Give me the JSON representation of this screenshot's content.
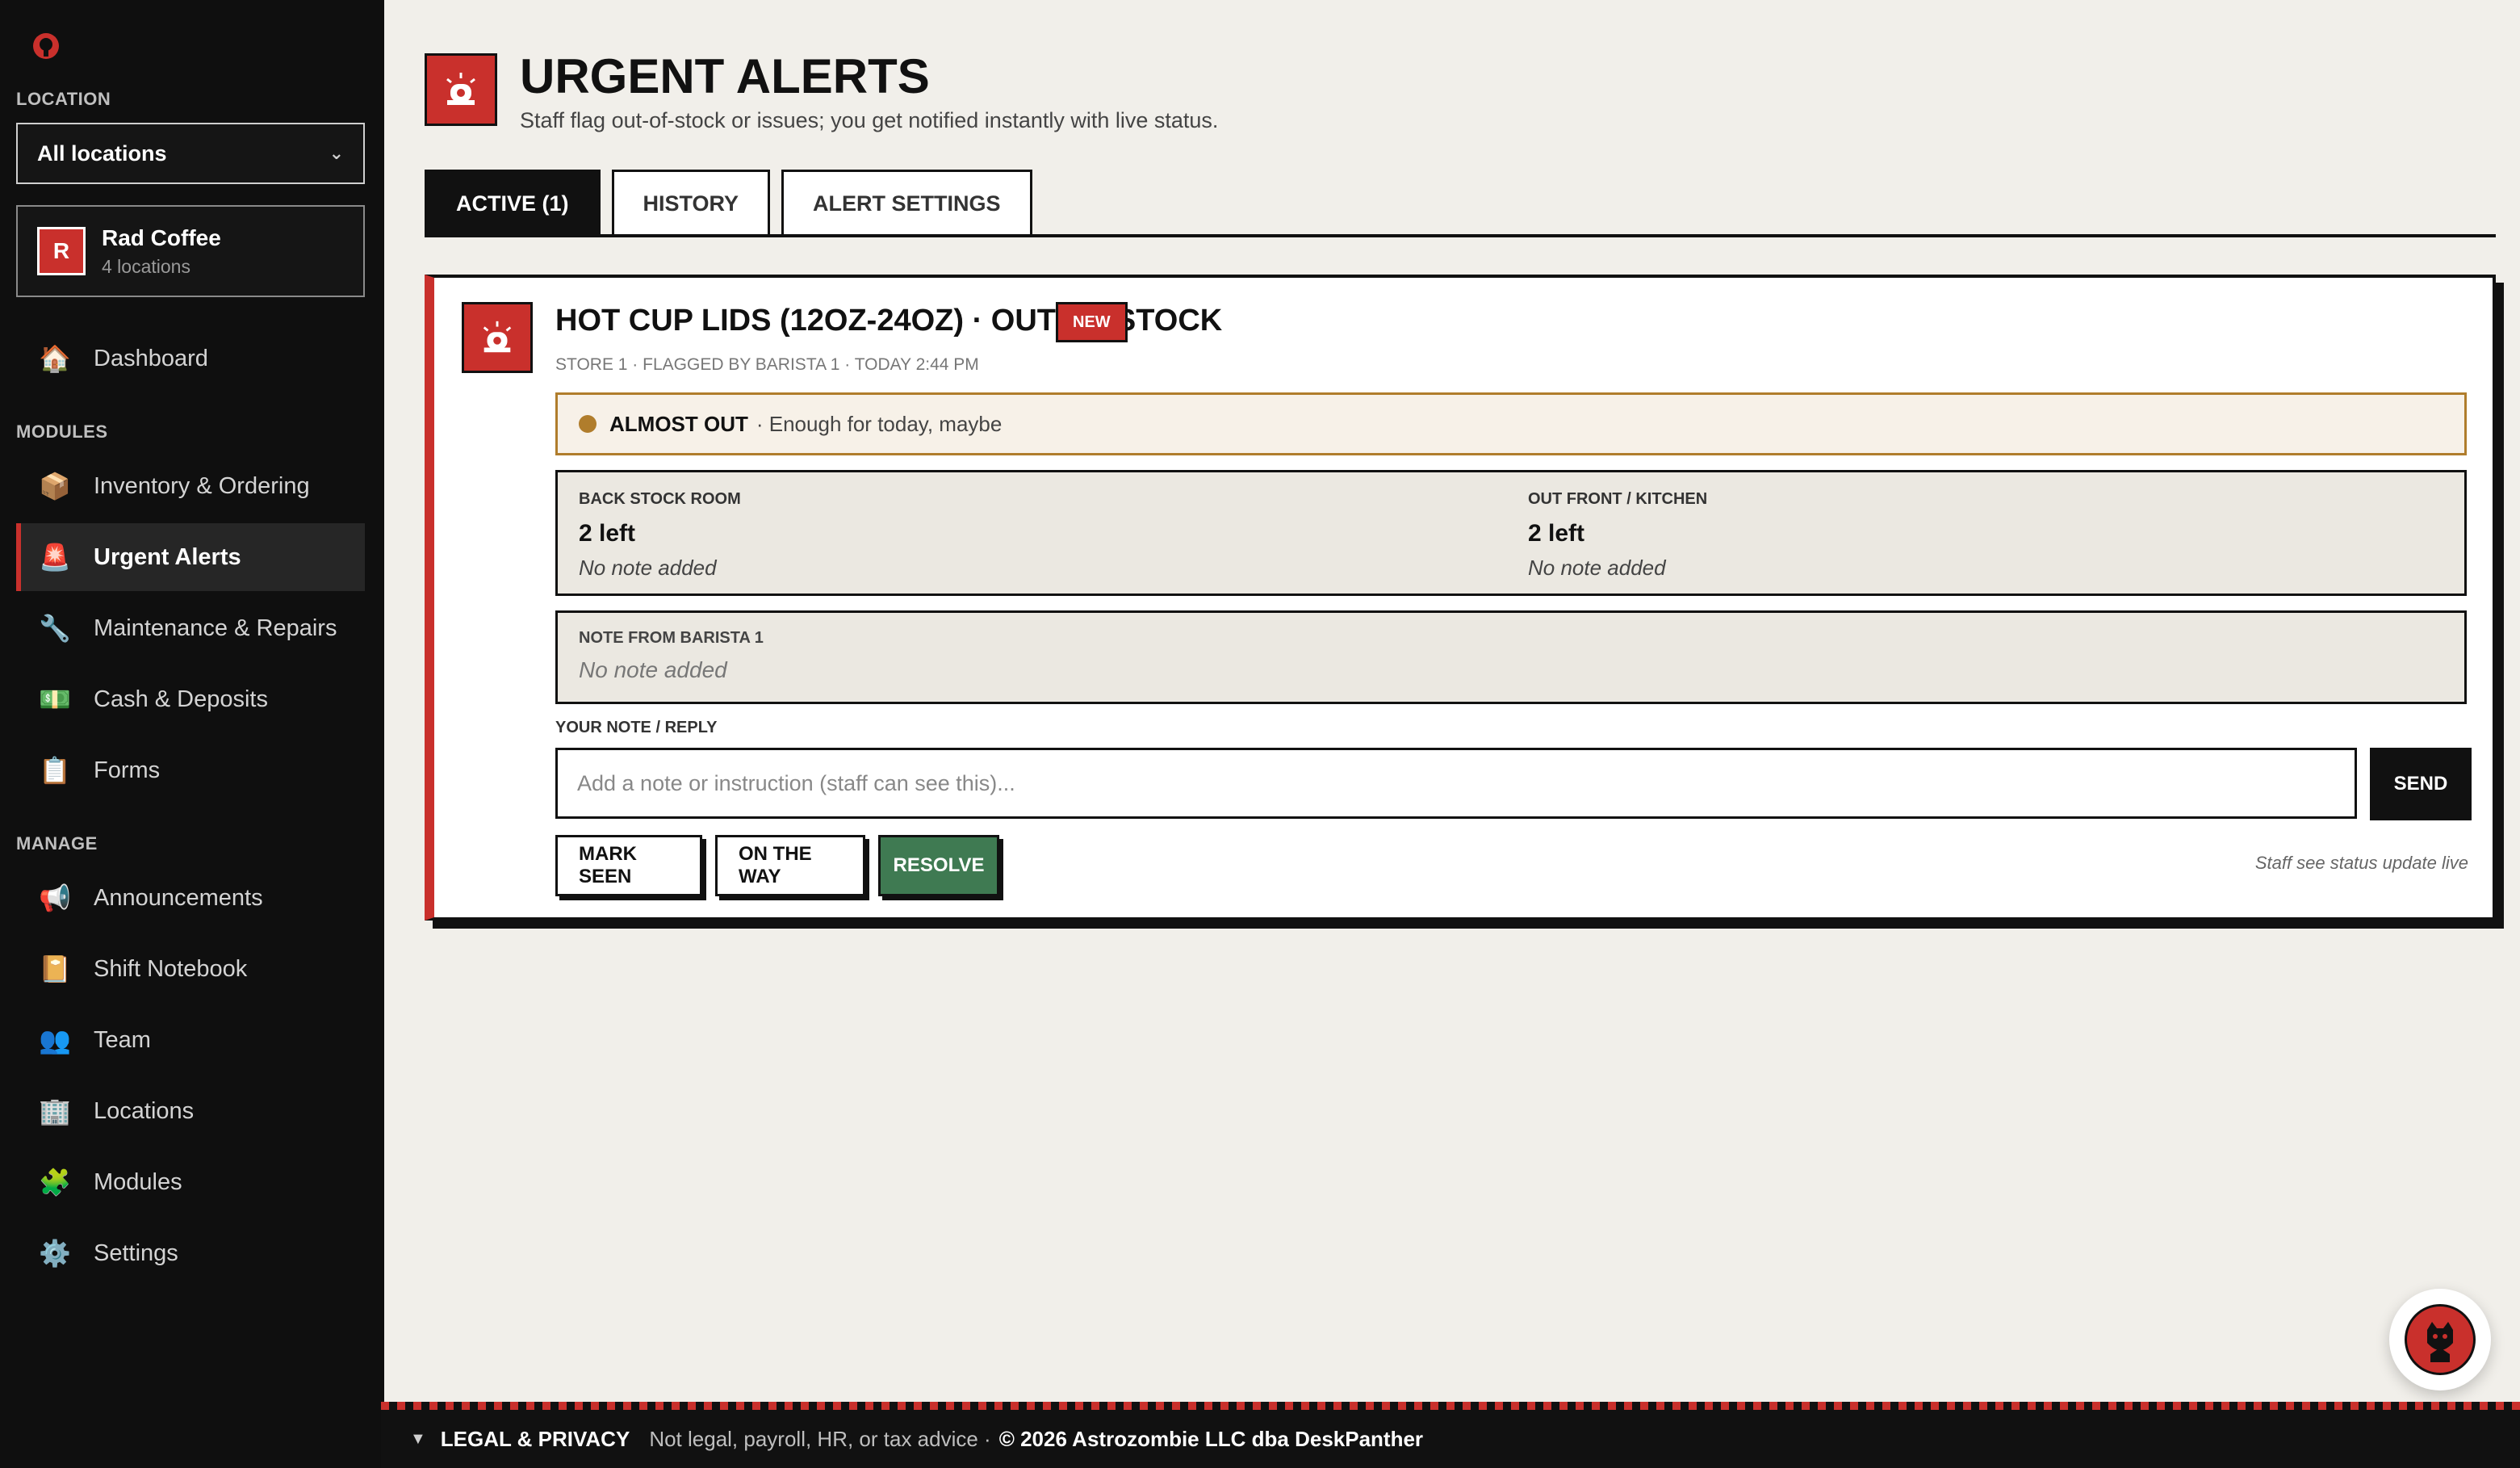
{
  "sidebar": {
    "location_label": "LOCATION",
    "location_value": "All locations",
    "org_initial": "R",
    "org_name": "Rad Coffee",
    "org_sub": "4 locations",
    "modules_label": "MODULES",
    "manage_label": "MANAGE",
    "items": [
      {
        "label": "Dashboard",
        "icon": "house-icon"
      },
      {
        "label": "Inventory & Ordering",
        "icon": "package-icon"
      },
      {
        "label": "Urgent Alerts",
        "icon": "siren-icon",
        "active": true
      },
      {
        "label": "Maintenance & Repairs",
        "icon": "wrench-icon"
      },
      {
        "label": "Cash & Deposits",
        "icon": "cash-icon"
      },
      {
        "label": "Forms",
        "icon": "clipboard-icon"
      },
      {
        "label": "Announcements",
        "icon": "megaphone-icon"
      },
      {
        "label": "Shift Notebook",
        "icon": "notebook-icon"
      },
      {
        "label": "Team",
        "icon": "people-icon"
      },
      {
        "label": "Locations",
        "icon": "building-icon"
      },
      {
        "label": "Modules",
        "icon": "puzzle-icon"
      },
      {
        "label": "Settings",
        "icon": "gear-icon"
      }
    ]
  },
  "header": {
    "title": "URGENT ALERTS",
    "subtitle": "Staff flag out-of-stock or issues; you get notified instantly with live status."
  },
  "tabs": [
    {
      "label": "ACTIVE (1)",
      "active": true
    },
    {
      "label": "HISTORY"
    },
    {
      "label": "ALERT SETTINGS"
    }
  ],
  "alert": {
    "title": "HOT CUP LIDS (12OZ-24OZ) · OUT OF STOCK",
    "badge": "NEW",
    "meta": "STORE 1 · FLAGGED BY BARISTA 1 · TODAY 2:44 PM",
    "status_label": "ALMOST OUT",
    "status_desc": "· Enough for today, maybe",
    "stock": [
      {
        "label": "BACK STOCK ROOM",
        "value": "2 left",
        "note": "No note added"
      },
      {
        "label": "OUT FRONT / KITCHEN",
        "value": "2 left",
        "note": "No note added"
      }
    ],
    "note_label": "NOTE FROM BARISTA 1",
    "note_text": "No note added",
    "reply_label": "YOUR NOTE / REPLY",
    "reply_placeholder": "Add a note or instruction (staff can see this)...",
    "send_label": "SEND",
    "actions": [
      "MARK SEEN",
      "ON THE WAY",
      "RESOLVE"
    ],
    "live_note": "Staff see status update live"
  },
  "footer": {
    "toggle": "▼",
    "legal": "LEGAL & PRIVACY",
    "disclaimer": "Not legal, payroll, HR, or tax advice ·",
    "copyright": "© 2026 Astrozombie LLC dba DeskPanther"
  },
  "colors": {
    "accent": "#c9302c",
    "sidebar_bg": "#0f0f0f",
    "page_bg": "#f1efea",
    "status_amber": "#b07d2c",
    "resolve_green": "#3f7a52"
  }
}
